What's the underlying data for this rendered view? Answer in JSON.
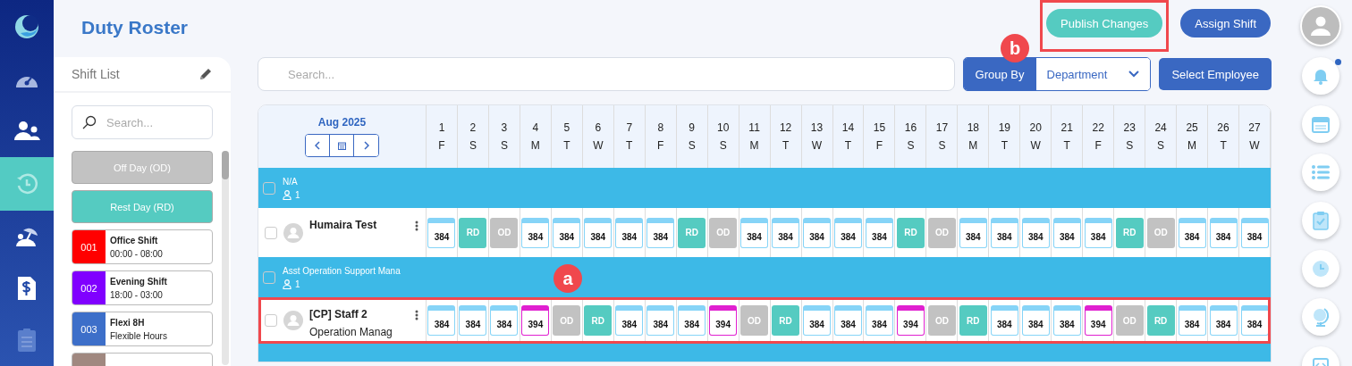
{
  "page_title": "Duty Roster",
  "nav": [
    {
      "selected": false
    },
    {
      "selected": false
    },
    {
      "selected": false
    },
    {
      "selected": true
    },
    {
      "selected": false
    },
    {
      "selected": false
    },
    {
      "selected": false
    }
  ],
  "actions": [
    {
      "label": "Publish Changes",
      "kind": "publish",
      "highlighted": true,
      "marker": "b"
    },
    {
      "label": "Assign Shift",
      "kind": "assign",
      "highlighted": false
    }
  ],
  "shift_list": {
    "title": "Shift List",
    "search": {
      "placeholder": "Search..."
    },
    "items": [
      {
        "kind": "od",
        "label": "Off Day (OD)"
      },
      {
        "kind": "rd",
        "label": "Rest Day (RD)"
      },
      {
        "kind": "shift",
        "code": "001",
        "color": "#ff0000",
        "name": "Office Shift",
        "time": "00:00 - 08:00"
      },
      {
        "kind": "shift",
        "code": "002",
        "color": "#8000ff",
        "name": "Evening Shift",
        "time": "18:00 - 03:00"
      },
      {
        "kind": "shift",
        "code": "003",
        "color": "#3d6fc9",
        "name": "Flexi 8H",
        "time": "Flexible Hours"
      },
      {
        "kind": "cut",
        "color": "#a08880"
      }
    ]
  },
  "search": {
    "placeholder": "Search..."
  },
  "group_by": {
    "label": "Group By",
    "value": "Department"
  },
  "select_employee": "Select Employee",
  "roster": {
    "month": "Aug 2025",
    "days": [
      {
        "d": "1",
        "w": "F"
      },
      {
        "d": "2",
        "w": "S"
      },
      {
        "d": "3",
        "w": "S"
      },
      {
        "d": "4",
        "w": "M"
      },
      {
        "d": "5",
        "w": "T"
      },
      {
        "d": "6",
        "w": "W"
      },
      {
        "d": "7",
        "w": "T"
      },
      {
        "d": "8",
        "w": "F"
      },
      {
        "d": "9",
        "w": "S"
      },
      {
        "d": "10",
        "w": "S"
      },
      {
        "d": "11",
        "w": "M"
      },
      {
        "d": "12",
        "w": "T"
      },
      {
        "d": "13",
        "w": "W"
      },
      {
        "d": "14",
        "w": "T"
      },
      {
        "d": "15",
        "w": "F"
      },
      {
        "d": "16",
        "w": "S"
      },
      {
        "d": "17",
        "w": "S"
      },
      {
        "d": "18",
        "w": "M"
      },
      {
        "d": "19",
        "w": "T"
      },
      {
        "d": "20",
        "w": "W"
      },
      {
        "d": "21",
        "w": "T"
      },
      {
        "d": "22",
        "w": "F"
      },
      {
        "d": "23",
        "w": "S"
      },
      {
        "d": "24",
        "w": "S"
      },
      {
        "d": "25",
        "w": "M"
      },
      {
        "d": "26",
        "w": "T"
      },
      {
        "d": "27",
        "w": "W"
      }
    ],
    "rows": [
      {
        "kind": "group",
        "name": "N/A",
        "count": "1",
        "checked": false
      },
      {
        "kind": "employee",
        "name": "Humaira Test",
        "checked": false,
        "highlighted": false,
        "cells": [
          {
            "kind": "shift",
            "label": "384",
            "color": "#86d4f7"
          },
          {
            "kind": "rd",
            "label": "RD"
          },
          {
            "kind": "od",
            "label": "OD"
          },
          {
            "kind": "shift",
            "label": "384",
            "color": "#86d4f7"
          },
          {
            "kind": "shift",
            "label": "384",
            "color": "#86d4f7"
          },
          {
            "kind": "shift",
            "label": "384",
            "color": "#86d4f7"
          },
          {
            "kind": "shift",
            "label": "384",
            "color": "#86d4f7"
          },
          {
            "kind": "shift",
            "label": "384",
            "color": "#86d4f7"
          },
          {
            "kind": "rd",
            "label": "RD"
          },
          {
            "kind": "od",
            "label": "OD"
          },
          {
            "kind": "shift",
            "label": "384",
            "color": "#86d4f7"
          },
          {
            "kind": "shift",
            "label": "384",
            "color": "#86d4f7"
          },
          {
            "kind": "shift",
            "label": "384",
            "color": "#86d4f7"
          },
          {
            "kind": "shift",
            "label": "384",
            "color": "#86d4f7"
          },
          {
            "kind": "shift",
            "label": "384",
            "color": "#86d4f7"
          },
          {
            "kind": "rd",
            "label": "RD"
          },
          {
            "kind": "od",
            "label": "OD"
          },
          {
            "kind": "shift",
            "label": "384",
            "color": "#86d4f7"
          },
          {
            "kind": "shift",
            "label": "384",
            "color": "#86d4f7"
          },
          {
            "kind": "shift",
            "label": "384",
            "color": "#86d4f7"
          },
          {
            "kind": "shift",
            "label": "384",
            "color": "#86d4f7"
          },
          {
            "kind": "shift",
            "label": "384",
            "color": "#86d4f7"
          },
          {
            "kind": "rd",
            "label": "RD"
          },
          {
            "kind": "od",
            "label": "OD"
          },
          {
            "kind": "shift",
            "label": "384",
            "color": "#86d4f7"
          },
          {
            "kind": "shift",
            "label": "384",
            "color": "#86d4f7"
          },
          {
            "kind": "shift",
            "label": "384",
            "color": "#86d4f7"
          }
        ]
      },
      {
        "kind": "group",
        "name": "Asst Operation Support Mana",
        "count": "1",
        "checked": false,
        "marker": "a"
      },
      {
        "kind": "employee",
        "name": "[CP] Staff 2",
        "subtitle": "Operation Manag",
        "checked": false,
        "highlighted": true,
        "cells": [
          {
            "kind": "shift",
            "label": "384",
            "color": "#86d4f7"
          },
          {
            "kind": "shift",
            "label": "384",
            "color": "#86d4f7"
          },
          {
            "kind": "shift",
            "label": "384",
            "color": "#86d4f7"
          },
          {
            "kind": "shift",
            "label": "394",
            "color": "#e020d0"
          },
          {
            "kind": "od",
            "label": "OD"
          },
          {
            "kind": "rd",
            "label": "RD"
          },
          {
            "kind": "shift",
            "label": "384",
            "color": "#86d4f7"
          },
          {
            "kind": "shift",
            "label": "384",
            "color": "#86d4f7"
          },
          {
            "kind": "shift",
            "label": "384",
            "color": "#86d4f7"
          },
          {
            "kind": "shift",
            "label": "394",
            "color": "#e020d0"
          },
          {
            "kind": "od",
            "label": "OD"
          },
          {
            "kind": "rd",
            "label": "RD"
          },
          {
            "kind": "shift",
            "label": "384",
            "color": "#86d4f7"
          },
          {
            "kind": "shift",
            "label": "384",
            "color": "#86d4f7"
          },
          {
            "kind": "shift",
            "label": "384",
            "color": "#86d4f7"
          },
          {
            "kind": "shift",
            "label": "394",
            "color": "#e020d0"
          },
          {
            "kind": "od",
            "label": "OD"
          },
          {
            "kind": "rd",
            "label": "RD"
          },
          {
            "kind": "shift",
            "label": "384",
            "color": "#86d4f7"
          },
          {
            "kind": "shift",
            "label": "384",
            "color": "#86d4f7"
          },
          {
            "kind": "shift",
            "label": "384",
            "color": "#86d4f7"
          },
          {
            "kind": "shift",
            "label": "394",
            "color": "#e020d0"
          },
          {
            "kind": "od",
            "label": "OD"
          },
          {
            "kind": "rd",
            "label": "RD"
          },
          {
            "kind": "shift",
            "label": "384",
            "color": "#86d4f7"
          },
          {
            "kind": "shift",
            "label": "384",
            "color": "#86d4f7"
          },
          {
            "kind": "shift",
            "label": "384",
            "color": "#86d4f7"
          }
        ]
      },
      {
        "kind": "group_cut"
      }
    ]
  },
  "right_bar": [
    {
      "badge": false
    },
    {
      "badge": true
    },
    {
      "badge": false
    },
    {
      "badge": false
    },
    {
      "badge": false
    },
    {
      "badge": false
    },
    {
      "badge": false
    },
    {
      "badge": false
    }
  ]
}
